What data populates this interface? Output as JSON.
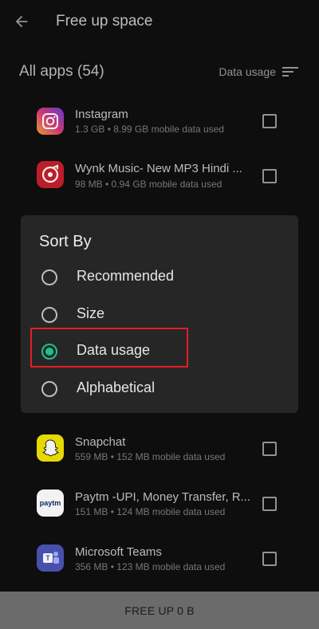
{
  "header": {
    "title": "Free up space"
  },
  "section": {
    "title": "All apps (54)",
    "sort_label": "Data usage"
  },
  "apps_top": [
    {
      "name": "Instagram",
      "details": "1.3 GB • 8.99 GB mobile data used",
      "icon": "instagram-icon"
    },
    {
      "name": "Wynk Music- New MP3 Hindi ...",
      "details": "98 MB • 0.94 GB mobile data used",
      "icon": "wynk-music-icon"
    }
  ],
  "dialog": {
    "title": "Sort By",
    "options": [
      {
        "label": "Recommended",
        "selected": false
      },
      {
        "label": "Size",
        "selected": false
      },
      {
        "label": "Data usage",
        "selected": true
      },
      {
        "label": "Alphabetical",
        "selected": false
      }
    ]
  },
  "apps_bottom": [
    {
      "name": "Snapchat",
      "details": "559 MB • 152 MB mobile data used",
      "icon": "snapchat-icon"
    },
    {
      "name": "Paytm -UPI, Money Transfer, R...",
      "details": "151 MB • 124 MB mobile data used",
      "icon": "paytm-icon"
    },
    {
      "name": "Microsoft Teams",
      "details": "356 MB • 123 MB mobile data used",
      "icon": "microsoft-teams-icon"
    }
  ],
  "footer": {
    "button_label": "FREE UP 0 B"
  },
  "colors": {
    "accent": "#1fbf8f",
    "highlight": "#e31e2a"
  }
}
